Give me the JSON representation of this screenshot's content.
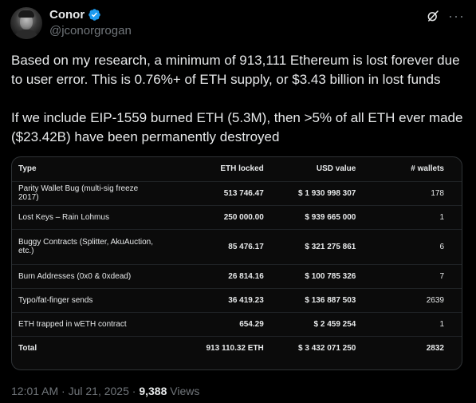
{
  "author": {
    "display_name": "Conor",
    "handle": "@jconorgrogan"
  },
  "icons": {
    "verified": "verified-badge-icon",
    "grok": "grok-icon",
    "more": "more-icon"
  },
  "colors": {
    "verified_blue": "#1d9bf0",
    "text": "#e7e9ea",
    "muted": "#71767b"
  },
  "tweet": {
    "paragraph1": "Based on my research, a minimum of 913,111 Ethereum is lost forever due to user error.  This is 0.76%+ of ETH supply, or $3.43 billion in lost funds",
    "paragraph2": "If we include EIP-1559 burned ETH (5.3M), then >5% of all ETH ever made ($23.42B) have been permanently destroyed"
  },
  "table": {
    "headers": [
      "Type",
      "ETH locked",
      "USD value",
      "# wallets"
    ],
    "rows": [
      [
        "Parity Wallet Bug (multi-sig freeze 2017)",
        "513 746.47",
        "$ 1 930 998 307",
        "178"
      ],
      [
        "Lost Keys – Rain Lohmus",
        "250 000.00",
        "$ 939 665 000",
        "1"
      ],
      [
        "Buggy Contracts (Splitter, AkuAuction, etc.)",
        "85 476.17",
        "$ 321 275 861",
        "6"
      ],
      [
        "Burn Addresses (0x0 & 0xdead)",
        "26 814.16",
        "$ 100 785 326",
        "7"
      ],
      [
        "Typo/fat-finger sends",
        "36 419.23",
        "$ 136 887 503",
        "2639"
      ],
      [
        "ETH trapped in wETH contract",
        "654.29",
        "$ 2 459 254",
        "1"
      ],
      [
        "Total",
        "913 110.32 ETH",
        "$ 3 432 071 250",
        "2832"
      ]
    ]
  },
  "meta": {
    "timestamp": "12:01 AM · Jul 21, 2025",
    "separator": " · ",
    "views_count": "9,388",
    "views_label": " Views"
  }
}
